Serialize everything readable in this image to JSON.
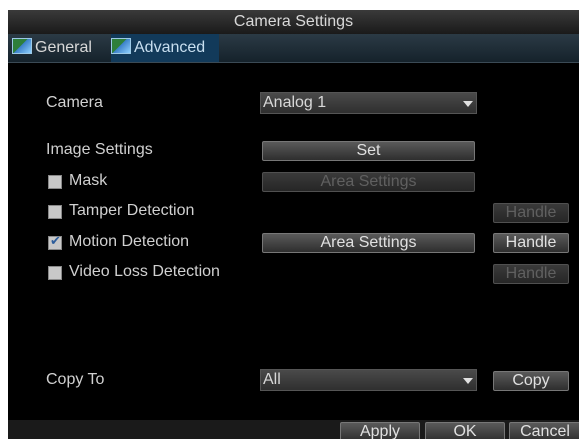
{
  "window": {
    "title": "Camera Settings"
  },
  "tabs": [
    {
      "label": "General",
      "active": false,
      "icon": "camera-settings-icon"
    },
    {
      "label": "Advanced",
      "active": true,
      "icon": "camera-settings-icon"
    }
  ],
  "form": {
    "camera_label": "Camera",
    "camera_value": "Analog 1",
    "image_settings_label": "Image Settings",
    "set_button": "Set",
    "mask": {
      "label": "Mask",
      "checked": false,
      "area_button": "Area Settings",
      "area_enabled": false
    },
    "tamper": {
      "label": "Tamper Detection",
      "checked": false,
      "handle_button": "Handle",
      "handle_enabled": false
    },
    "motion": {
      "label": "Motion Detection",
      "checked": true,
      "area_button": "Area Settings",
      "area_enabled": true,
      "handle_button": "Handle",
      "handle_enabled": true
    },
    "video_loss": {
      "label": "Video Loss Detection",
      "checked": false,
      "handle_button": "Handle",
      "handle_enabled": false
    },
    "copy_to_label": "Copy To",
    "copy_to_value": "All",
    "copy_button": "Copy"
  },
  "footer": {
    "apply_button": "Apply",
    "ok_button": "OK",
    "cancel_button": "Cancel"
  },
  "colors": {
    "window_bg": "#000000",
    "active_tab": "#123a5a",
    "text": "#d0d0d0",
    "disabled_text": "#606060"
  }
}
